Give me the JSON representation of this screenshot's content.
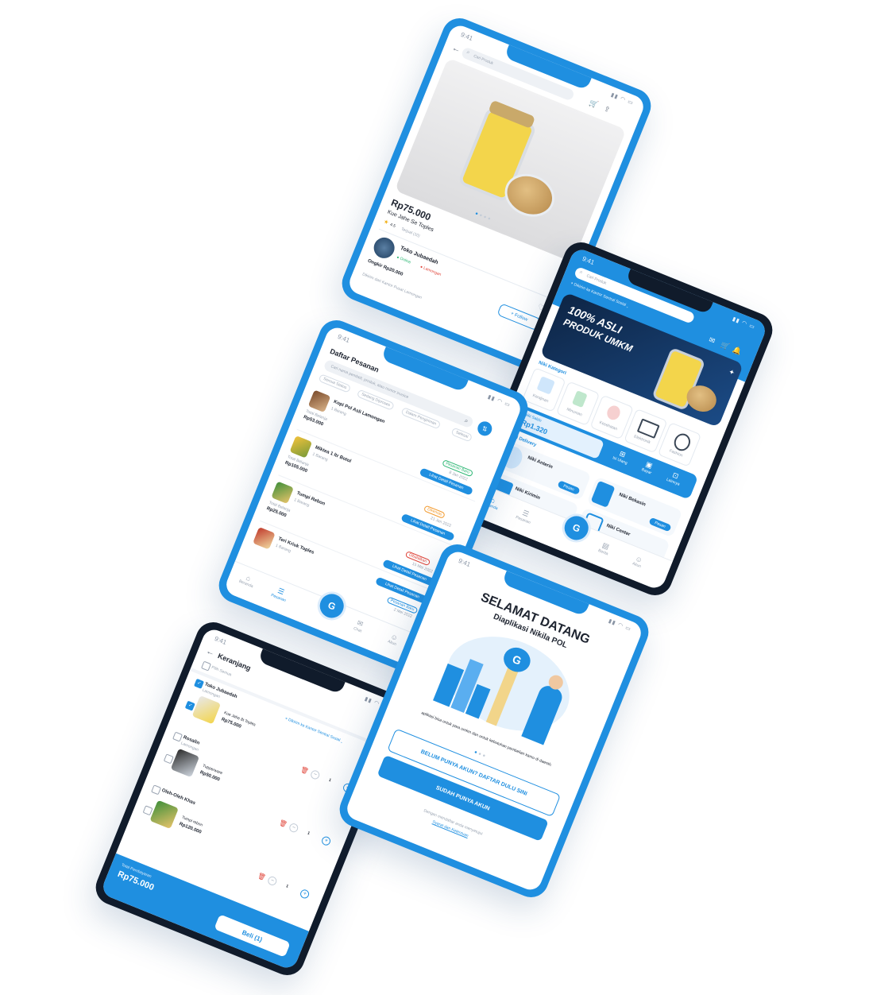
{
  "status_time": "9:41",
  "product": {
    "search_placeholder": "Cari Produk",
    "price": "Rp75.000",
    "name": "Kue Jahe Se Toples",
    "rating": "4.5",
    "sold": "Terjual (10)",
    "store_name": "Toko Jubaedah",
    "store_status_online": "Online",
    "store_location": "Lamongan",
    "shipping": "Ongkir Rp20.000",
    "follow_label": "+ Follow",
    "bottom_text": "Dikirim dari Kantor Pusat Lamongan"
  },
  "home": {
    "search_placeholder": "Cari Produk",
    "location": "Dikirim ke Kantor Sentral Sosial",
    "banner_line1": "100% ASLI",
    "banner_line2": "PRODUK UMKM",
    "category_title": "Niki Kategori",
    "categories": [
      "Kerajinan",
      "Minuman",
      "Kesehatan",
      "Elektronik",
      "Fashion"
    ],
    "saldo_label": "Niki Saldo",
    "saldo_value": "Rp1.320",
    "saldo_actions": [
      "Isi Ulang",
      "Bayar",
      "Lainnya"
    ],
    "delivery_title": "Niki Delivery",
    "services": [
      "Niki Anterin",
      "Niki Bekasin",
      "Niki Kirimin",
      "Niki Center"
    ],
    "service_button": "Pesan",
    "nav": [
      "Beranda",
      "Pesanan",
      "Berita",
      "Akun"
    ]
  },
  "orders": {
    "title": "Daftar Pesanan",
    "search_placeholder": "Cari nama pembeli, produk, atau nomor invoice",
    "filters": [
      "Semua Status",
      "Sedang Diproses",
      "Dalam Pengiriman",
      "Selesai"
    ],
    "items": [
      {
        "name": "Kopi Pol Asli Lamongan",
        "qty": "1 Barang",
        "total_label": "Total Belanja",
        "total": "Rp53.000",
        "status": "Pesanan Baru",
        "date": "8 Jan 2022",
        "action": "Lihat Detail Pesanan"
      },
      {
        "name": "Miktea 1 ltr Botol",
        "qty": "1 Barang",
        "total_label": "Total Belanja",
        "total": "Rp105.000",
        "status": "Dikemas",
        "date": "21 Jan 2022",
        "action": "Lihat Detail Pesanan"
      },
      {
        "name": "Tumpi Rebon",
        "qty": "1 Barang",
        "total_label": "Total Belanja",
        "total": "Rp25.000",
        "status": "Dibatalkan",
        "date": "15 Mei 2022",
        "action": "Lihat Detail Pesanan"
      },
      {
        "name": "Teri Kriuk Toples",
        "qty": "1 Barang",
        "total_label": "Total Belanja",
        "total": "",
        "status": "Pesanan Baru",
        "date": "2 Mei 2022",
        "action": "Lihat Detail Pesanan"
      }
    ],
    "nav": [
      "Beranda",
      "Pesanan",
      "Chat",
      "Akun"
    ]
  },
  "cart": {
    "title": "Keranjang",
    "select_all": "Pilih Semua",
    "send_to": "Dikirim ke Kantor Sentral Sosial",
    "groups": [
      {
        "store": "Toko Jubaedah",
        "location": "Lamongan",
        "product": "Kue Jahe 8t Toples",
        "price": "Rp75.000",
        "qty": "1",
        "checked": true
      },
      {
        "store": "Rosalin",
        "location": "Lamongan",
        "product": "Tupperware",
        "price": "Rp50.000",
        "qty": "1",
        "checked": false
      },
      {
        "store": "Oleh-Oleh Khas",
        "location": "",
        "product": "Tumpi rebon",
        "price": "Rp120.000",
        "qty": "1",
        "checked": false
      }
    ],
    "total_label": "Total Pembayaran",
    "total": "Rp75.000",
    "buy_label": "Beli (1)"
  },
  "welcome": {
    "title": "SELAMAT DATANG",
    "subtitle": "Diaplikasi Nikila POL",
    "description": "aplikasi bisa untuk para umkm dan untuk kebutuhan pembelian kamu di daerah.",
    "register_label": "BELUM PUNYA AKUN? DAFTAR DULU SINI",
    "login_label": "SUDAH PUNYA AKUN",
    "terms_prefix": "Dengan mendaftar anda menyetujui",
    "terms_link": "Syarat dan Ketentuan"
  },
  "colors": {
    "primary": "#1f8fe0",
    "dark": "#101b2b",
    "success": "#2bb673",
    "danger": "#e0453a",
    "warning": "#f29a2e"
  }
}
